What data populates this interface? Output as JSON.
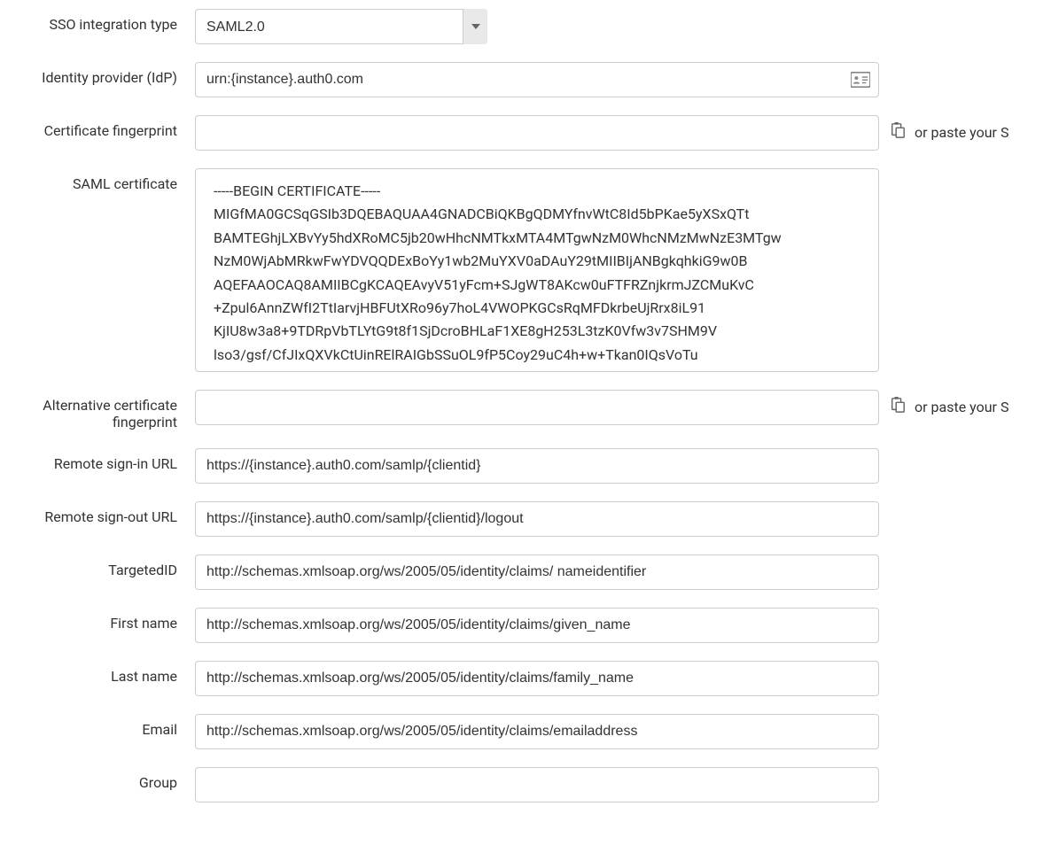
{
  "labels": {
    "sso_type": "SSO integration type",
    "idp": "Identity provider (IdP)",
    "cert_fp": "Certificate fingerprint",
    "saml_cert": "SAML certificate",
    "alt_cert_fp": "Alternative certificate fingerprint",
    "signin_url": "Remote sign-in URL",
    "signout_url": "Remote sign-out URL",
    "targeted_id": "TargetedID",
    "first_name": "First name",
    "last_name": "Last name",
    "email": "Email",
    "group": "Group"
  },
  "values": {
    "sso_type": "SAML2.0",
    "idp": "urn:{instance}.auth0.com",
    "cert_fp": "",
    "saml_cert": "-----BEGIN CERTIFICATE-----\nMIGfMA0GCSqGSIb3DQEBAQUAA4GNADCBiQKBgQDMYfnvWtC8Id5bPKae5yXSxQTt\nBAMTEGhjLXBvYy5hdXRoMC5jb20wHhcNMTkxMTA4MTgwNzM0WhcNMzMwNzE3MTgw\nNzM0WjAbMRkwFwYDVQQDExBoYy1wb2MuYXV0aDAuY29tMIIBIjANBgkqhkiG9w0B\nAQEFAAOCAQ8AMIIBCgKCAQEAvyV51yFcm+SJgWT8AKcw0uFTFRZnjkrmJZCMuKvC\n+Zpul6AnnZWfI2TtIarvjHBFUtXRo96y7hoL4VWOPKGCsRqMFDkrbeUjRrx8iL91\nKjIU8w3a8+9TDRpVbTLYtG9t8f1SjDcroBHLaF1XE8gH253L3tzK0Vfw3v7SHM9V\nlso3/gsf/CfJIxQXVkCtUinRElRAIGbSSuOL9fP5Coy29uC4h+w+Tkan0IQsVoTu",
    "alt_cert_fp": "",
    "signin_url": "https://{instance}.auth0.com/samlp/{clientid}",
    "signout_url": "https://{instance}.auth0.com/samlp/{clientid}/logout",
    "targeted_id": "http://schemas.xmlsoap.org/ws/2005/05/identity/claims/",
    "targeted_id_placeholder": "nameidentifier",
    "first_name": "http://schemas.xmlsoap.org/ws/2005/05/identity/claims/given_name",
    "last_name": "http://schemas.xmlsoap.org/ws/2005/05/identity/claims/family_name",
    "email": "http://schemas.xmlsoap.org/ws/2005/05/identity/claims/emailaddress",
    "group": ""
  },
  "aux": {
    "paste_text": "or paste your S"
  }
}
